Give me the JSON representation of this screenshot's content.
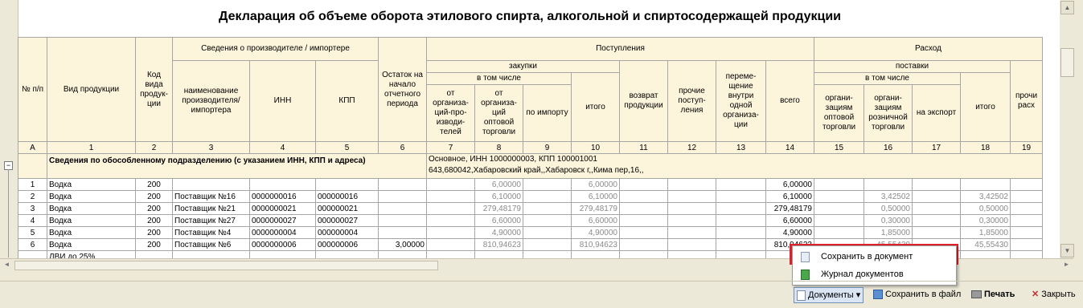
{
  "title": "Декларация об объеме оборота этилового спирта, алкогольной и спиртосодержащей продукции",
  "headers": {
    "np": "№ п/п",
    "vid": "Вид продукции",
    "kod": "Код вида продук-ции",
    "svedenia": "Сведения о производителе / импортере",
    "naim": "наименование производителя/ импортера",
    "inn": "ИНН",
    "kpp": "КПП",
    "ostatok": "Остаток на начало отчетного периода",
    "postuplenia": "Поступления",
    "zakupki": "закупки",
    "v_tom_chisle": "в том числе",
    "ot_proizv": "от организа-ций-про-изводи-телей",
    "ot_opt": "от организа-ций оптовой торговли",
    "po_importu": "по импорту",
    "itogo": "итого",
    "vozvrat": "возврат продукции",
    "prochie_post": "прочие поступ-ления",
    "peremeshenie": "переме-щение внутри одной организа-ции",
    "vsego": "всего",
    "rashod": "Расход",
    "postavki": "поставки",
    "v_tom_chisle2": "в том числе",
    "org_opt": "органи-зациям оптовой торговли",
    "org_rozn": "органи-зациям розничной торговли",
    "na_eksport": "на экспорт",
    "itogo2": "итого",
    "prochiy": "прочи расх"
  },
  "index_row": [
    "А",
    "1",
    "2",
    "3",
    "4",
    "5",
    "6",
    "7",
    "8",
    "9",
    "10",
    "11",
    "12",
    "13",
    "14",
    "15",
    "16",
    "17",
    "18",
    "19"
  ],
  "section": {
    "label": "Сведения по обособленному подразделению (с указанием ИНН, КПП и адреса)",
    "line1": "Основное, ИНН 1000000003, КПП 100001001",
    "line2": "643,680042,Хабаровский край,,Хабаровск г,,Кима пер,16,,"
  },
  "rows": [
    {
      "n": "1",
      "vid": "Водка",
      "kod": "200",
      "naim": "",
      "inn": "",
      "kpp": "",
      "ost": "",
      "c7": "",
      "c8": "6,00000",
      "c9": "",
      "c10": "6,00000",
      "c14": "6,00000",
      "c16": "",
      "c18": ""
    },
    {
      "n": "2",
      "vid": "Водка",
      "kod": "200",
      "naim": "Поставщик №16",
      "inn": "0000000016",
      "kpp": "000000016",
      "ost": "",
      "c7": "",
      "c8": "6,10000",
      "c9": "",
      "c10": "6,10000",
      "c14": "6,10000",
      "c16": "3,42502",
      "c18": "3,42502"
    },
    {
      "n": "3",
      "vid": "Водка",
      "kod": "200",
      "naim": "Поставщик №21",
      "inn": "0000000021",
      "kpp": "000000021",
      "ost": "",
      "c7": "",
      "c8": "279,48179",
      "c9": "",
      "c10": "279,48179",
      "c14": "279,48179",
      "c16": "0,50000",
      "c18": "0,50000"
    },
    {
      "n": "4",
      "vid": "Водка",
      "kod": "200",
      "naim": "Поставщик №27",
      "inn": "0000000027",
      "kpp": "000000027",
      "ost": "",
      "c7": "",
      "c8": "6,60000",
      "c9": "",
      "c10": "6,60000",
      "c14": "6,60000",
      "c16": "0,30000",
      "c18": "0,30000"
    },
    {
      "n": "5",
      "vid": "Водка",
      "kod": "200",
      "naim": "Поставщик №4",
      "inn": "0000000004",
      "kpp": "000000004",
      "ost": "",
      "c7": "",
      "c8": "4,90000",
      "c9": "",
      "c10": "4,90000",
      "c14": "4,90000",
      "c16": "1,85000",
      "c18": "1,85000"
    },
    {
      "n": "6",
      "vid": "Водка",
      "kod": "200",
      "naim": "Поставщик №6",
      "inn": "0000000006",
      "kpp": "000000006",
      "ost": "3,00000",
      "c7": "",
      "c8": "810,94623",
      "c9": "",
      "c10": "810,94623",
      "c14": "810,94623",
      "c16": "45,55430",
      "c18": "45,55430"
    },
    {
      "n": "",
      "vid": "ЛВИ до 25%",
      "kod": "",
      "naim": "",
      "inn": "",
      "kpp": "",
      "ost": "",
      "c7": "",
      "c8": "",
      "c9": "",
      "c10": "",
      "c14": "",
      "c16": "",
      "c18": ""
    }
  ],
  "menu": {
    "save_to_doc": "Сохранить в документ",
    "journal": "Журнал документов"
  },
  "toolbar": {
    "documents": "Документы",
    "save_file": "Сохранить в файл",
    "print": "Печать",
    "close": "Закрыть"
  }
}
